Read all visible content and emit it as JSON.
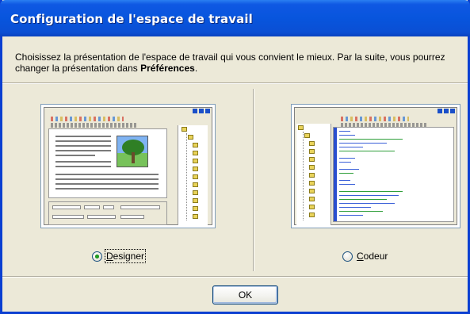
{
  "dialog": {
    "title": "Configuration de l'espace de travail",
    "intro_text": "Choisissez la présentation de l'espace de travail qui vous convient le mieux. Par la suite, vous pourrez changer la présentation dans ",
    "intro_bold": "Préférences",
    "intro_end": "."
  },
  "options": {
    "designer": {
      "label_accesskey": "D",
      "label_rest": "esigner",
      "checked": true
    },
    "coder": {
      "label_accesskey": "C",
      "label_rest": "odeur",
      "checked": false
    }
  },
  "buttons": {
    "ok_label": "OK"
  },
  "colors": {
    "titlebar": "#0855dd",
    "face": "#ece9d8",
    "radio_dot": "#21a121",
    "border": "#0b3fd1"
  },
  "icons": {
    "designer_preview": "designer-layout-thumbnail",
    "coder_preview": "coder-layout-thumbnail"
  }
}
